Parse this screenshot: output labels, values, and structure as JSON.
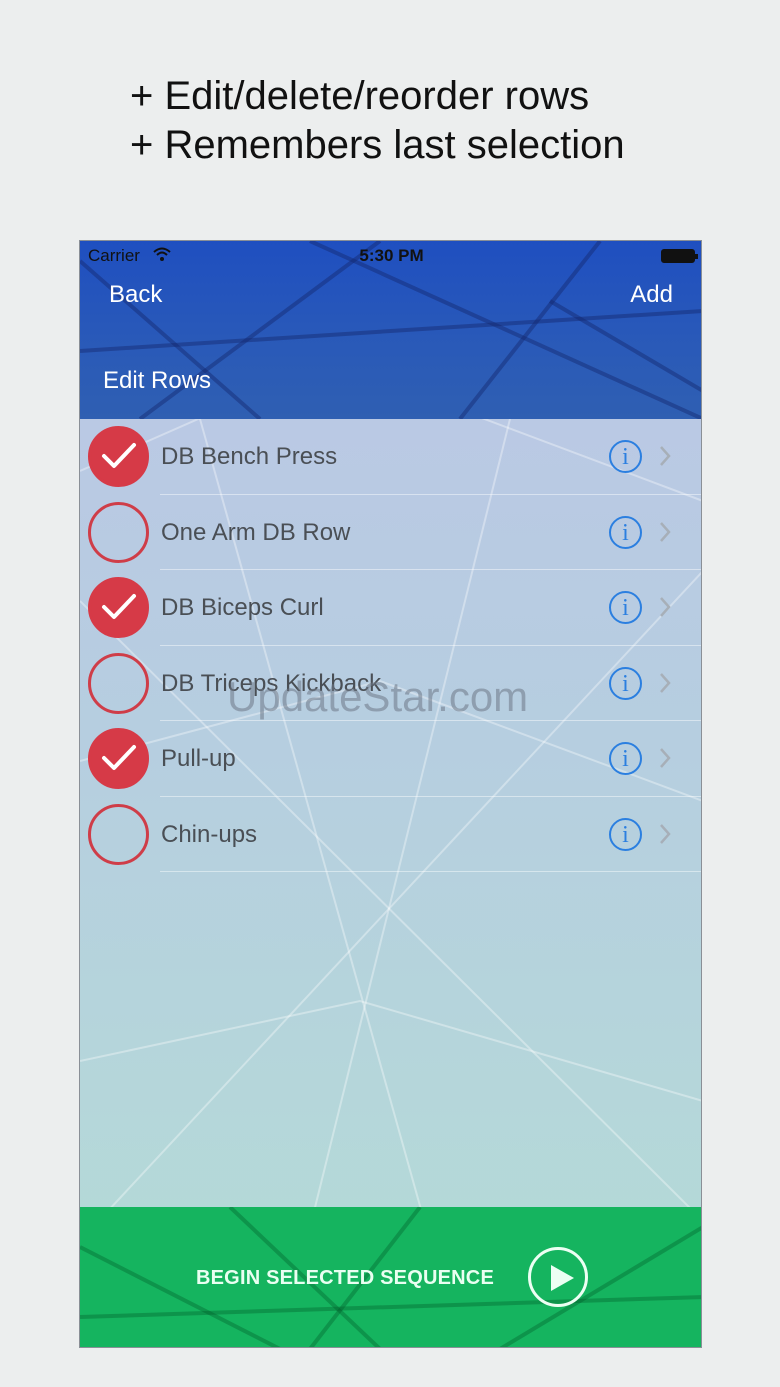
{
  "caption": {
    "line1": "+ Edit/delete/reorder rows",
    "line2": "+ Remembers last selection"
  },
  "status_bar": {
    "carrier": "Carrier",
    "time": "5:30 PM"
  },
  "nav": {
    "back_label": "Back",
    "add_label": "Add",
    "title": "Edit Rows"
  },
  "rows": [
    {
      "label": "DB Bench Press",
      "checked": true
    },
    {
      "label": "One Arm DB Row",
      "checked": false
    },
    {
      "label": "DB Biceps Curl",
      "checked": true
    },
    {
      "label": "DB Triceps Kickback",
      "checked": false
    },
    {
      "label": "Pull-up",
      "checked": true
    },
    {
      "label": "Chin-ups",
      "checked": false
    }
  ],
  "info_glyph": "i",
  "watermark": "UpdateStar.com",
  "footer": {
    "button_label": "BEGIN SELECTED SEQUENCE"
  },
  "colors": {
    "header": "#1f4fc0",
    "check": "#d63a47",
    "info": "#2b7fe0",
    "footer": "#15b45f"
  }
}
